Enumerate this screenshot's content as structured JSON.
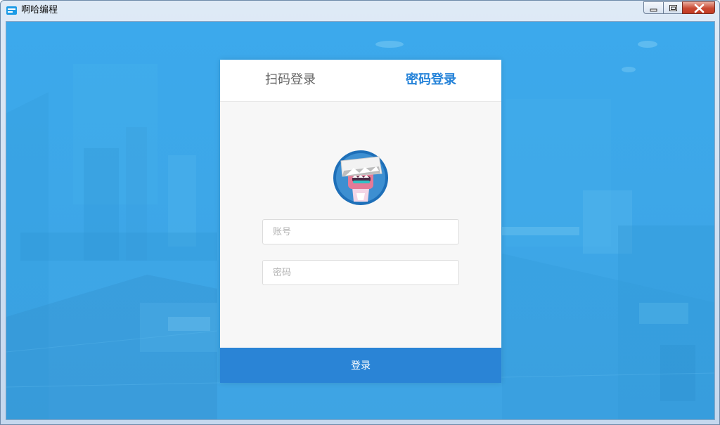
{
  "window": {
    "title": "啊哈编程",
    "controls": {
      "minimize": "minimize-icon",
      "maximize": "maximize-icon",
      "close": "close-icon"
    }
  },
  "login": {
    "tabs": [
      {
        "label": "扫码登录",
        "active": false
      },
      {
        "label": "密码登录",
        "active": true
      }
    ],
    "account": {
      "placeholder": "账号",
      "value": ""
    },
    "password": {
      "placeholder": "密码",
      "value": ""
    },
    "submit_label": "登录"
  },
  "colors": {
    "background": "#3eabea",
    "accent": "#2a84d6",
    "active_tab": "#2784d9",
    "card": "#f7f7f7"
  }
}
